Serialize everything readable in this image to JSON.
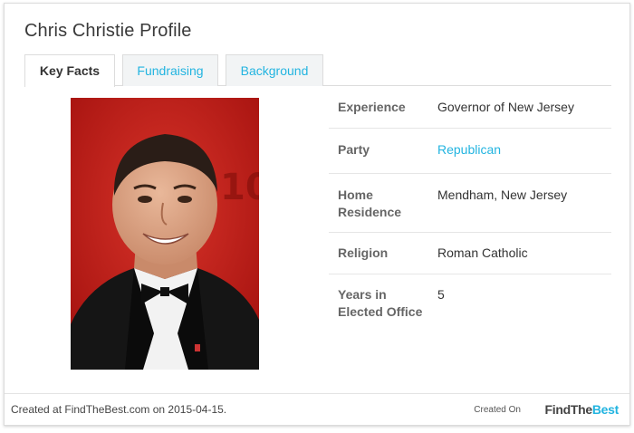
{
  "profile": {
    "title": "Chris Christie Profile"
  },
  "tabs": [
    {
      "label": "Key Facts",
      "active": true
    },
    {
      "label": "Fundraising",
      "active": false
    },
    {
      "label": "Background",
      "active": false
    }
  ],
  "facts": [
    {
      "label": "Experience",
      "value": "Governor of New Jersey"
    },
    {
      "label": "Party",
      "value": "Republican"
    },
    {
      "label": "Home Residence",
      "value": "Mendham, New Jersey"
    },
    {
      "label": "Religion",
      "value": "Roman Catholic"
    },
    {
      "label": "Years in Elected Office",
      "value": "5"
    }
  ],
  "footer": {
    "created_text": "Created at FindTheBest.com on 2015-04-15.",
    "created_on_label": "Created On",
    "brand_main": "FindThe",
    "brand_accent": "Best"
  },
  "colors": {
    "accent": "#22b4e0",
    "photo_background": "#c8201c"
  }
}
